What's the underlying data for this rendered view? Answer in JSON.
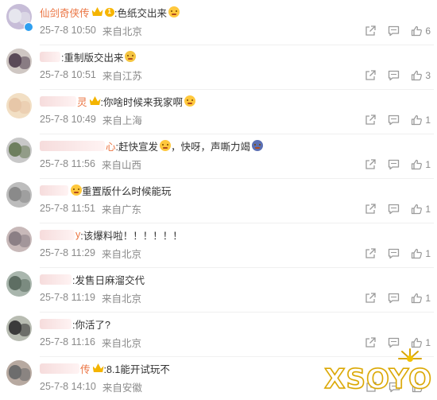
{
  "colors": {
    "username": "#eb7340",
    "meta": "#8a8a8a",
    "text": "#333333",
    "icon": "#9a9a9a",
    "badge": "#f7b500",
    "verified": "#2f9ff0",
    "watermark": "#d9a500"
  },
  "icons": {
    "share": "share-icon",
    "comment": "comment-icon",
    "like": "thumb-up-icon"
  },
  "comments": [
    {
      "username": "仙剑奇侠传",
      "badge": "crown-vip",
      "level": "1",
      "text": ":色纸交出来",
      "emoji": "laugh",
      "time": "25-7-8 10:50",
      "location": "来自北京",
      "likes": "6",
      "avatar_colors": [
        "#e6e6ee",
        "#c7bdd8"
      ]
    },
    {
      "username": "",
      "text": ":重制版交出来",
      "emoji": "bless",
      "time": "25-7-8 10:51",
      "location": "来自江苏",
      "likes": "3",
      "avatar_colors": [
        "#5a4a58",
        "#cfc7c3"
      ]
    },
    {
      "username": "灵",
      "text": ":你啥时候来我家啊",
      "emoji": "sweat",
      "time": "25-7-8 10:49",
      "location": "来自上海",
      "likes": "1",
      "avatar_colors": [
        "#e7c7a8",
        "#f2dfc4"
      ]
    },
    {
      "username": "心",
      "text": ":赶快宣发",
      "emoji": "sweat",
      "text2": "，快呀，声嘶力竭",
      "emoji2": "cry",
      "time": "25-7-8 11:56",
      "location": "来自山西",
      "likes": "1",
      "avatar_colors": [
        "#6e7f5e",
        "#c8c8c8"
      ]
    },
    {
      "username": "",
      "text": "重置版什么时候能玩",
      "emoji": "",
      "time": "25-7-8 11:51",
      "location": "来自广东",
      "likes": "1",
      "avatar_colors": [
        "#8a8a8a",
        "#bdbdbd"
      ]
    },
    {
      "username": "y",
      "text": ":该爆料啦！！！！！！",
      "emoji": "",
      "time": "25-7-8 11:29",
      "location": "来自北京",
      "likes": "1",
      "avatar_colors": [
        "#8b7f85",
        "#c8b9b9"
      ]
    },
    {
      "username": "",
      "text": ":发售日麻溜交代",
      "emoji": "",
      "time": "25-7-8 11:19",
      "location": "来自北京",
      "likes": "1",
      "avatar_colors": [
        "#5e6e63",
        "#a9b6ad"
      ]
    },
    {
      "username": "",
      "text": ":你活了?",
      "emoji": "",
      "time": "25-7-8 11:16",
      "location": "来自北京",
      "likes": "1",
      "avatar_colors": [
        "#3b3b3b",
        "#b8bcb2"
      ]
    },
    {
      "username": "传",
      "text": ":8.1能开试玩不",
      "emoji": "",
      "time": "25-7-8 14:10",
      "location": "来自安徽",
      "likes": "",
      "avatar_colors": [
        "#6d6d6d",
        "#b7a9a0"
      ]
    }
  ],
  "watermark": {
    "text": "XSOYO"
  }
}
